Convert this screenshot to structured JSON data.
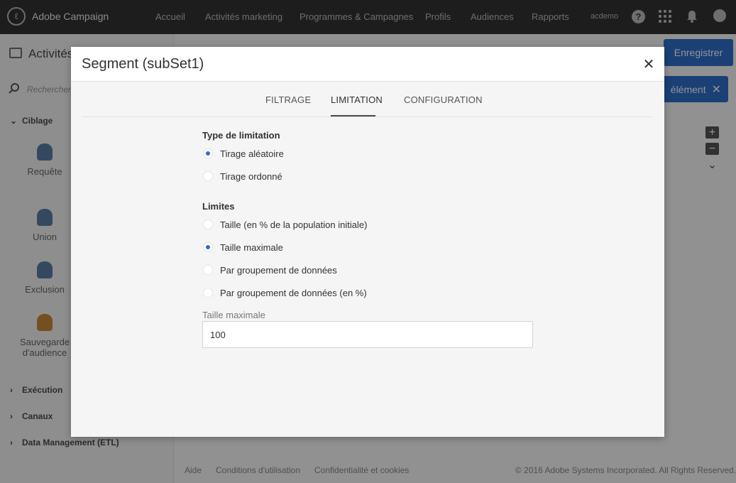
{
  "app": {
    "brand": "Adobe Campaign",
    "nav": [
      "Accueil",
      "Activités marketing",
      "Programmes & Campagnes",
      "Profils",
      "Audiences",
      "Rapports"
    ],
    "user": "acdemo",
    "help": "?"
  },
  "page": {
    "title": "Activités",
    "search_placeholder": "Rechercher",
    "save_label": "Enregistrer",
    "add_label": "élément",
    "sections": {
      "ciblage": "Ciblage",
      "execution": "Exécution",
      "canaux": "Canaux",
      "etl": "Data Management (ETL)"
    },
    "activities": [
      "Requête",
      "Union",
      "Exclusion",
      "Sauvegarde d'audience"
    ],
    "footer": {
      "aide": "Aide",
      "conditions": "Conditions d'utilisation",
      "confidentialite": "Confidentialité et cookies",
      "copyright": "© 2016 Adobe Systems Incorporated. All Rights Reserved."
    }
  },
  "modal": {
    "title": "Segment (subSet1)",
    "tabs": [
      "FILTRAGE",
      "LIMITATION",
      "CONFIGURATION"
    ],
    "active_tab": "LIMITATION",
    "limitation_type": {
      "label": "Type de limitation",
      "options": [
        "Tirage aléatoire",
        "Tirage ordonné"
      ],
      "selected": "Tirage aléatoire"
    },
    "limits": {
      "label": "Limites",
      "options": [
        "Taille (en % de la population initiale)",
        "Taille maximale",
        "Par groupement de données",
        "Par groupement de données (en %)"
      ],
      "selected": "Taille maximale"
    },
    "max_size": {
      "label": "Taille maximale",
      "value": "100"
    }
  },
  "colors": {
    "topbar": "#323232",
    "accent": "#2d6ecb",
    "overlay": "rgba(0,0,0,0.42)"
  }
}
